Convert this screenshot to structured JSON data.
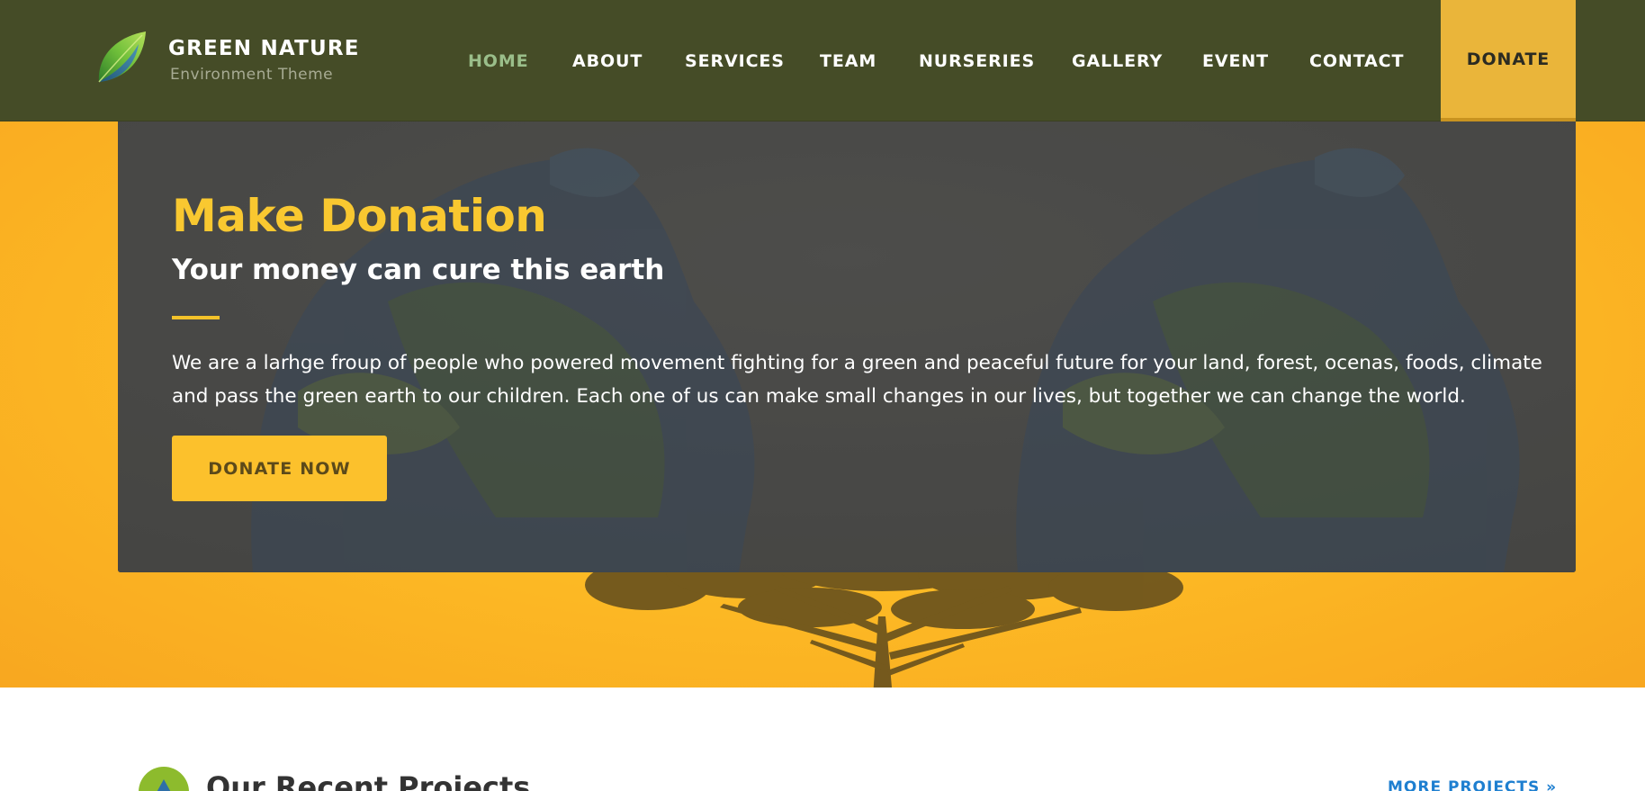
{
  "brand": {
    "name": "GREEN NATURE",
    "tagline": "Environment Theme",
    "logo_icon": "leaf-icon"
  },
  "nav": {
    "items": [
      {
        "label": "HOME",
        "active": true
      },
      {
        "label": "ABOUT",
        "active": false
      },
      {
        "label": "SERVICES",
        "active": false
      },
      {
        "label": "TEAM",
        "active": false
      },
      {
        "label": "NURSERIES",
        "active": false
      },
      {
        "label": "GALLERY",
        "active": false
      },
      {
        "label": "EVENT",
        "active": false
      },
      {
        "label": "CONTACT",
        "active": false
      }
    ],
    "donate_label": "DONATE"
  },
  "hero": {
    "title": "Make Donation",
    "subtitle": "Your money can cure this earth",
    "body": "We are a larhge froup of people who powered movement fighting for a green and peaceful future for your land, forest, ocenas, foods, climate and pass the green earth to our children. Each one of us can make small changes in our lives, but together we can change the world.",
    "button_label": "DONATE NOW"
  },
  "projects": {
    "title": "Our Recent Projects",
    "more_label": "MORE PROJECTS  »"
  },
  "colors": {
    "header_bg": "#454c27",
    "active_nav": "#9abe8a",
    "accent_yellow": "#fcc12c",
    "donate_bg": "#eab53a",
    "panel_bg": "#4a4a48",
    "link_blue": "#1e7fd0"
  }
}
